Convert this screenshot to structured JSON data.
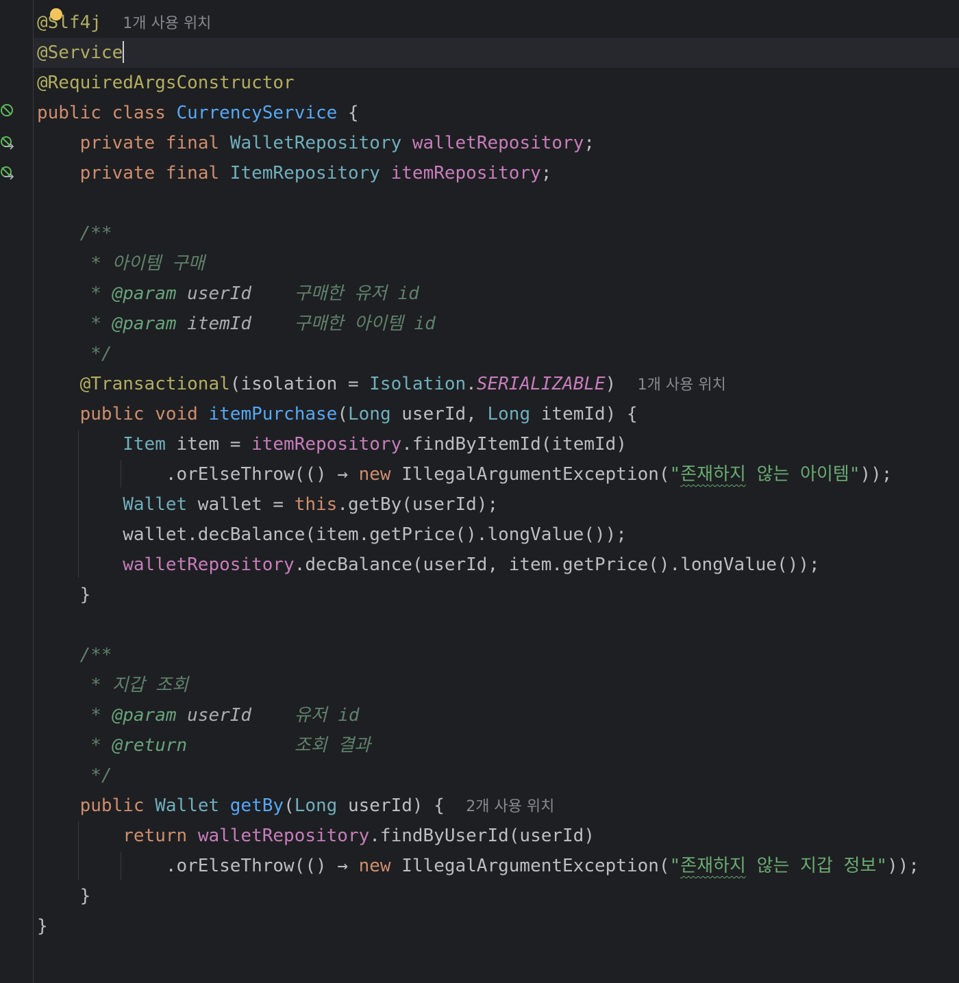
{
  "code": {
    "l1": {
      "ann": "@Slf4j",
      "hint": "1개 사용 위치"
    },
    "l2": {
      "ann": "@Service"
    },
    "l3": {
      "ann": "@RequiredArgsConstructor"
    },
    "l4": {
      "kw1": "public",
      "kw2": "class",
      "cls": "CurrencyService",
      "rest": " {"
    },
    "l5": {
      "kw1": "private",
      "kw2": "final",
      "type": "WalletRepository",
      "field": "walletRepository",
      "rest": ";"
    },
    "l6": {
      "kw1": "private",
      "kw2": "final",
      "type": "ItemRepository",
      "field": "itemRepository",
      "rest": ";"
    },
    "l8": {
      "doc": "/**"
    },
    "l9": {
      "doc": " * 아이템 구매"
    },
    "l10": {
      "star": " * ",
      "tag": "@param",
      "param": " userId",
      "desc": "    구매한 유저 id"
    },
    "l11": {
      "star": " * ",
      "tag": "@param",
      "param": " itemId",
      "desc": "    구매한 아이템 id"
    },
    "l12": {
      "doc": " */"
    },
    "l13": {
      "ann": "@Transactional",
      "p1": "(isolation = ",
      "cls": "Isolation",
      "dot": ".",
      "cst": "SERIALIZABLE",
      "p2": ")",
      "hint": "1개 사용 위치"
    },
    "l14": {
      "kw1": "public",
      "kw2": "void",
      "mth": "itemPurchase",
      "p1": "(",
      "t1": "Long",
      "a1": " userId, ",
      "t2": "Long",
      "a2": " itemId) {"
    },
    "l15": {
      "type": "Item",
      "a1": " item = ",
      "field": "itemRepository",
      "a2": ".findByItemId(itemId)"
    },
    "l16": {
      "a1": ".orElseThrow(() → ",
      "kw": "new",
      "a2": " IllegalArgumentException(",
      "q1": "\"",
      "sq": "존재하지",
      "s2": " 않는 아이템\"",
      "a3": "));"
    },
    "l17": {
      "type": "Wallet",
      "a1": " wallet = ",
      "kw": "this",
      "a2": ".getBy(userId);"
    },
    "l18": {
      "a1": "wallet.decBalance(item.getPrice().longValue());"
    },
    "l19": {
      "field": "walletRepository",
      "a1": ".decBalance(userId, item.getPrice().longValue());"
    },
    "l20": {
      "a1": "}"
    },
    "l22": {
      "doc": "/**"
    },
    "l23": {
      "doc": " * 지갑 조회"
    },
    "l24": {
      "star": " * ",
      "tag": "@param",
      "param": " userId",
      "desc": "    유저 id"
    },
    "l25": {
      "star": " * ",
      "tag": "@return",
      "desc": "          조회 결과"
    },
    "l26": {
      "doc": " */"
    },
    "l27": {
      "kw1": "public",
      "type": "Wallet",
      "mth": "getBy",
      "p1": "(",
      "t1": "Long",
      "a1": " userId) {",
      "hint": "2개 사용 위치"
    },
    "l28": {
      "kw": "return",
      "field": "walletRepository",
      "a1": ".findByUserId(userId)"
    },
    "l29": {
      "a1": ".orElseThrow(() → ",
      "kw": "new",
      "a2": " IllegalArgumentException(",
      "q1": "\"",
      "sq": "존재하지",
      "s2": " 않는 지갑 정보\"",
      "a3": "));"
    },
    "l30": {
      "a1": "}"
    },
    "l31": {
      "a1": "}"
    }
  }
}
